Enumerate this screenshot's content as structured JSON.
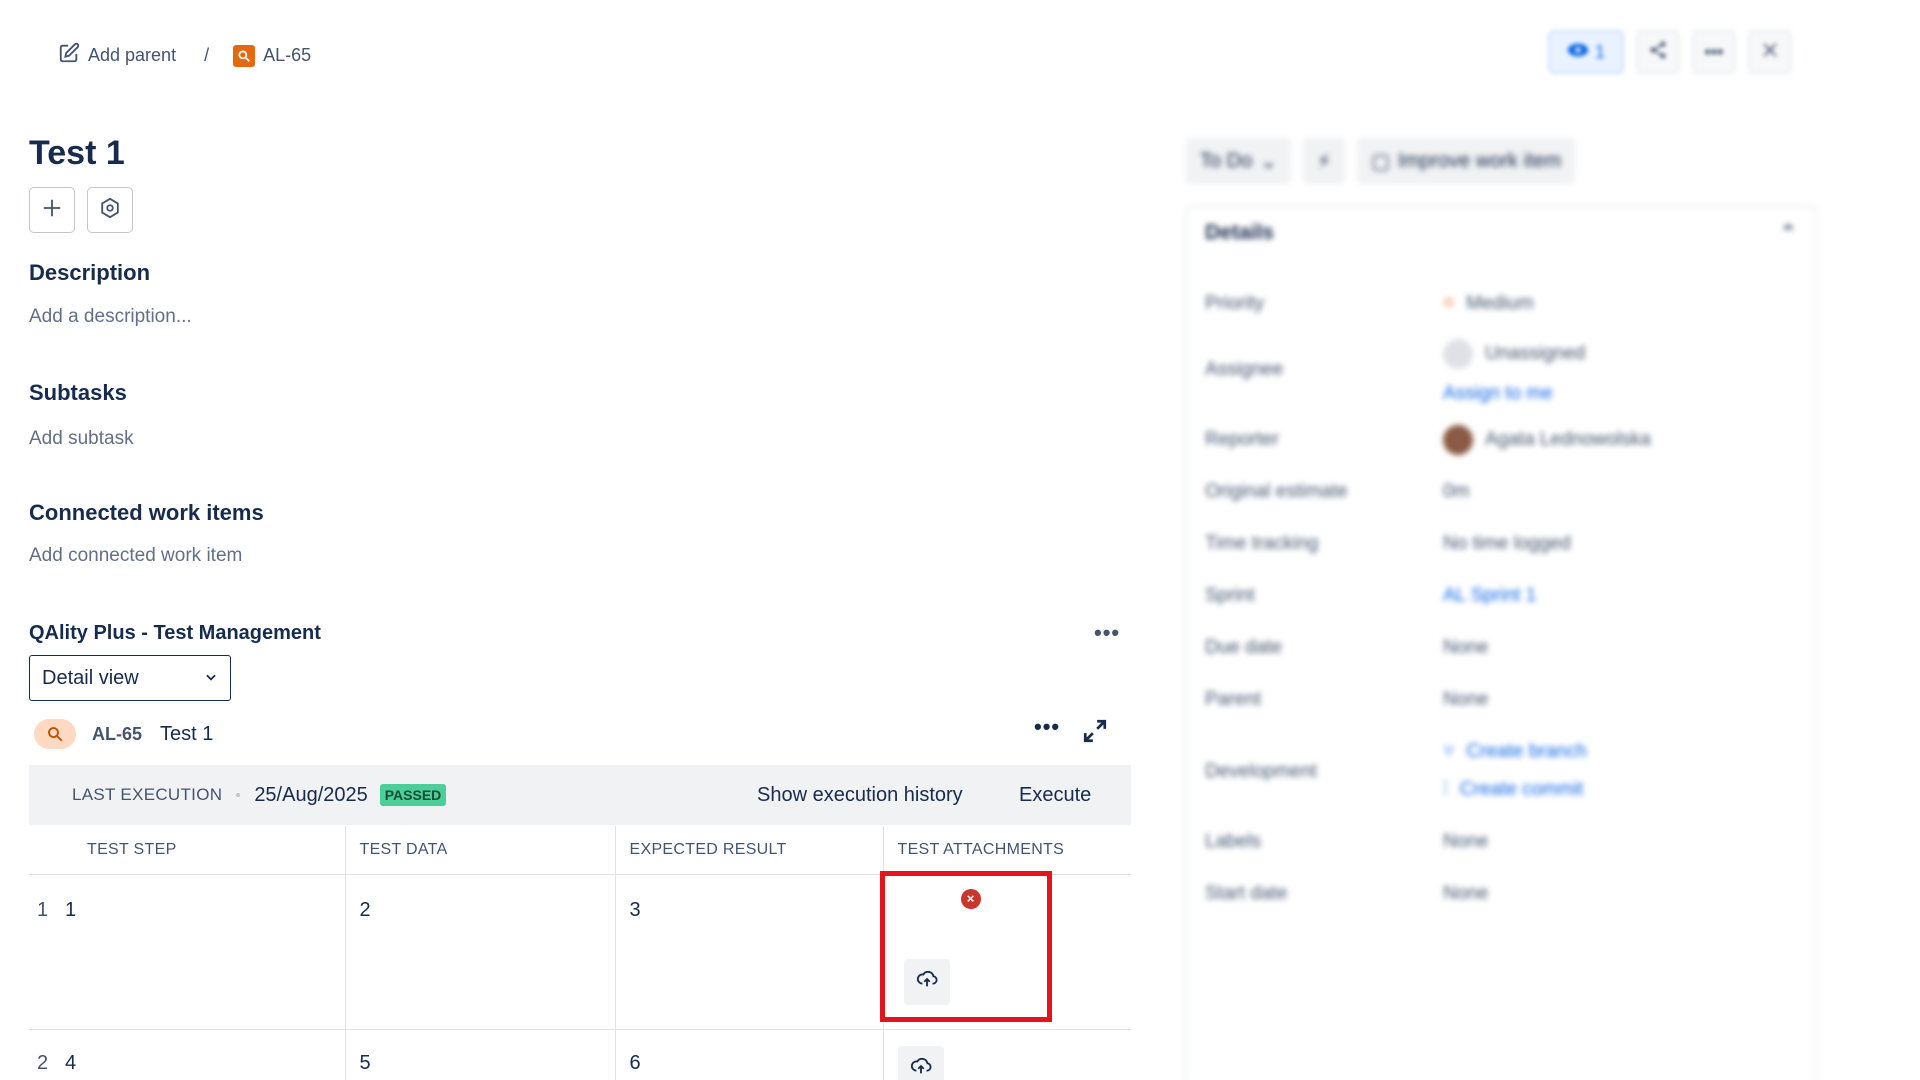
{
  "header": {
    "add_parent": "Add parent",
    "separator": "/",
    "issue_key": "AL-65",
    "watch_count": "1"
  },
  "issue": {
    "title": "Test 1",
    "description_heading": "Description",
    "description_placeholder": "Add a description...",
    "subtasks_heading": "Subtasks",
    "subtasks_placeholder": "Add subtask",
    "connected_heading": "Connected work items",
    "connected_placeholder": "Add connected work item"
  },
  "qality": {
    "title": "QAlity Plus - Test Management",
    "view_select": "Detail view",
    "test_key": "AL-65",
    "test_name": "Test 1",
    "last_execution_label": "LAST EXECUTION",
    "last_execution_date": "25/Aug/2025",
    "status_badge": "PASSED",
    "history_link": "Show execution history",
    "execute_link": "Execute",
    "columns": [
      "TEST STEP",
      "TEST DATA",
      "EXPECTED RESULT",
      "TEST ATTACHMENTS"
    ],
    "rows": [
      {
        "index": "1",
        "step": "1",
        "data": "2",
        "expected": "3"
      },
      {
        "index": "2",
        "step": "4",
        "data": "5",
        "expected": "6"
      }
    ]
  },
  "side": {
    "status": "To Do",
    "improve": "Improve work item",
    "details_heading": "Details",
    "fields": {
      "priority_label": "Priority",
      "priority_value": "Medium",
      "assignee_label": "Assignee",
      "assignee_value": "Unassigned",
      "assign_to_me": "Assign to me",
      "reporter_label": "Reporter",
      "reporter_value": "Agata Lednowolska",
      "estimate_label": "Original estimate",
      "estimate_value": "0m",
      "time_label": "Time tracking",
      "time_value": "No time logged",
      "sprint_label": "Sprint",
      "sprint_value": "AL Sprint 1",
      "due_label": "Due date",
      "due_value": "None",
      "parent_label": "Parent",
      "parent_value": "None",
      "dev_label": "Development",
      "create_branch": "Create branch",
      "create_commit": "Create commit",
      "labels_label": "Labels",
      "labels_value": "None",
      "start_label": "Start date",
      "start_value": "None"
    }
  },
  "colors": {
    "accent": "#0c66e4",
    "passed": "#4bce97",
    "highlight": "#e5131c",
    "issue_icon": "#e56910"
  }
}
